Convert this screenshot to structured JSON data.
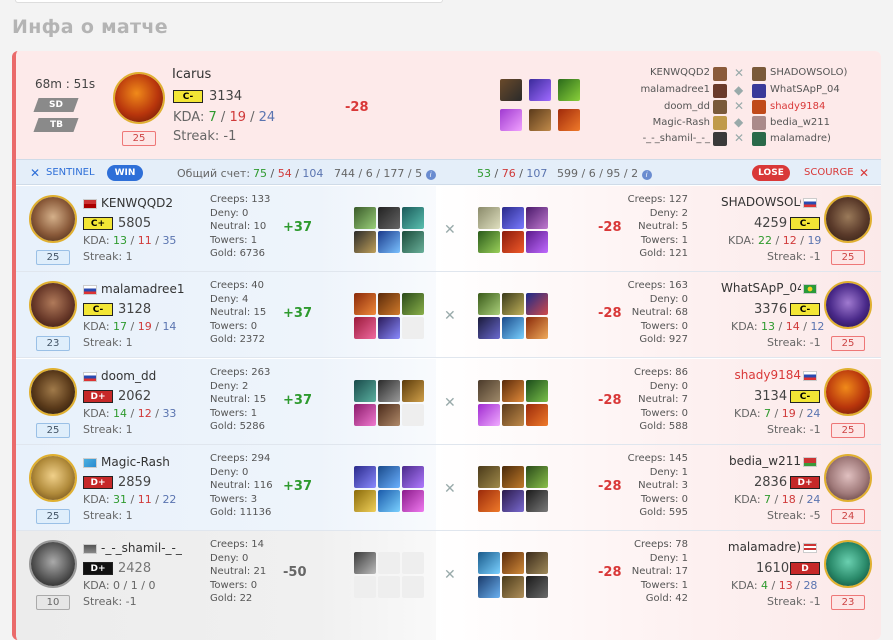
{
  "page_title": "Инфа о матче",
  "summary": {
    "duration": "68m : 51s",
    "tags": [
      "SD",
      "TB"
    ],
    "player": {
      "name": "Icarus",
      "rank": "C-",
      "rating": "3134",
      "kda_label": "KDA:",
      "kills": "7",
      "deaths": "19",
      "assists": "24",
      "streak_label": "Streak:",
      "streak": "-1",
      "level": "25"
    },
    "delta": "-28",
    "left_names": [
      "KENWQQD2",
      "malamadree1",
      "doom_dd",
      "Magic-Rash",
      "-_-_shamil-_-_"
    ],
    "right_names": [
      "SHADOWSOLO)",
      "WhatSApP_04",
      "shady9184",
      "bedia_w211",
      "malamadre)"
    ]
  },
  "teams": {
    "sentinel_label": "SENTINEL",
    "win_label": "WIN",
    "score_label": "Общий счет:",
    "s_kills": "75",
    "s_deaths": "54",
    "s_assists": "104",
    "s_extra": "744 / 6 / 177 / 5",
    "sc_kills": "53",
    "sc_deaths": "76",
    "sc_assists": "107",
    "sc_extra": "599 / 6 / 95 / 2",
    "lose_label": "LOSE",
    "scourge_label": "SCOURGE"
  },
  "labels": {
    "kda": "KDA:",
    "streak": "Streak:",
    "creeps": "Creeps:",
    "deny": "Deny:",
    "neutral": "Neutral:",
    "towers": "Towers:",
    "gold": "Gold:"
  },
  "rows": [
    {
      "left": {
        "name": "KENWQQD2",
        "rank": "C+",
        "rating": "5805",
        "k": "13",
        "d": "11",
        "a": "35",
        "streak": "1",
        "level": "25",
        "creeps": "133",
        "deny": "0",
        "neutral": "10",
        "towers": "1",
        "gold": "6736",
        "delta": "+37"
      },
      "right": {
        "name": "SHADOWSOLO",
        "rank": "C-",
        "rating": "4259",
        "k": "22",
        "d": "12",
        "a": "19",
        "streak": "-1",
        "level": "25",
        "creeps": "127",
        "deny": "2",
        "neutral": "5",
        "towers": "1",
        "gold": "121",
        "delta": "-28"
      }
    },
    {
      "left": {
        "name": "malamadree1",
        "rank": "C-",
        "rating": "3128",
        "k": "17",
        "d": "19",
        "a": "14",
        "streak": "1",
        "level": "23",
        "creeps": "40",
        "deny": "4",
        "neutral": "15",
        "towers": "0",
        "gold": "2372",
        "delta": "+37"
      },
      "right": {
        "name": "WhatSApP_04",
        "rank": "C-",
        "rating": "3376",
        "k": "13",
        "d": "14",
        "a": "12",
        "streak": "-1",
        "level": "25",
        "creeps": "163",
        "deny": "0",
        "neutral": "68",
        "towers": "0",
        "gold": "927",
        "delta": "-28"
      }
    },
    {
      "left": {
        "name": "doom_dd",
        "rank": "D+",
        "rating": "2062",
        "k": "14",
        "d": "12",
        "a": "33",
        "streak": "1",
        "level": "25",
        "creeps": "263",
        "deny": "2",
        "neutral": "15",
        "towers": "1",
        "gold": "5286",
        "delta": "+37"
      },
      "right": {
        "name": "shady9184",
        "rank": "C-",
        "rating": "3134",
        "k": "7",
        "d": "19",
        "a": "24",
        "streak": "-1",
        "level": "25",
        "creeps": "86",
        "deny": "0",
        "neutral": "7",
        "towers": "0",
        "gold": "588",
        "delta": "-28"
      }
    },
    {
      "left": {
        "name": "Magic-Rash",
        "rank": "D+",
        "rating": "2859",
        "k": "31",
        "d": "11",
        "a": "22",
        "streak": "1",
        "level": "25",
        "creeps": "294",
        "deny": "0",
        "neutral": "116",
        "towers": "3",
        "gold": "11136",
        "delta": "+37"
      },
      "right": {
        "name": "bedia_w211",
        "rank": "D+",
        "rating": "2836",
        "k": "7",
        "d": "18",
        "a": "24",
        "streak": "-5",
        "level": "24",
        "creeps": "145",
        "deny": "1",
        "neutral": "3",
        "towers": "0",
        "gold": "595",
        "delta": "-28"
      }
    },
    {
      "left": {
        "name": "-_-_shamil-_-_",
        "rank": "D+",
        "rating": "2428",
        "k": "0",
        "d": "1",
        "a": "0",
        "streak": "-1",
        "level": "10",
        "creeps": "14",
        "deny": "0",
        "neutral": "21",
        "towers": "0",
        "gold": "22",
        "delta": "-50"
      },
      "right": {
        "name": "malamadre)",
        "rank": "D",
        "rating": "1610",
        "k": "4",
        "d": "13",
        "a": "28",
        "streak": "-1",
        "level": "23",
        "creeps": "78",
        "deny": "1",
        "neutral": "17",
        "towers": "1",
        "gold": "42",
        "delta": "-28"
      }
    }
  ],
  "colors": {
    "win": "#2e6fd8",
    "lose": "#d93838",
    "positive": "#2e9a2e",
    "negative": "#d93838",
    "accent_left_border": "#ea6a6a"
  }
}
